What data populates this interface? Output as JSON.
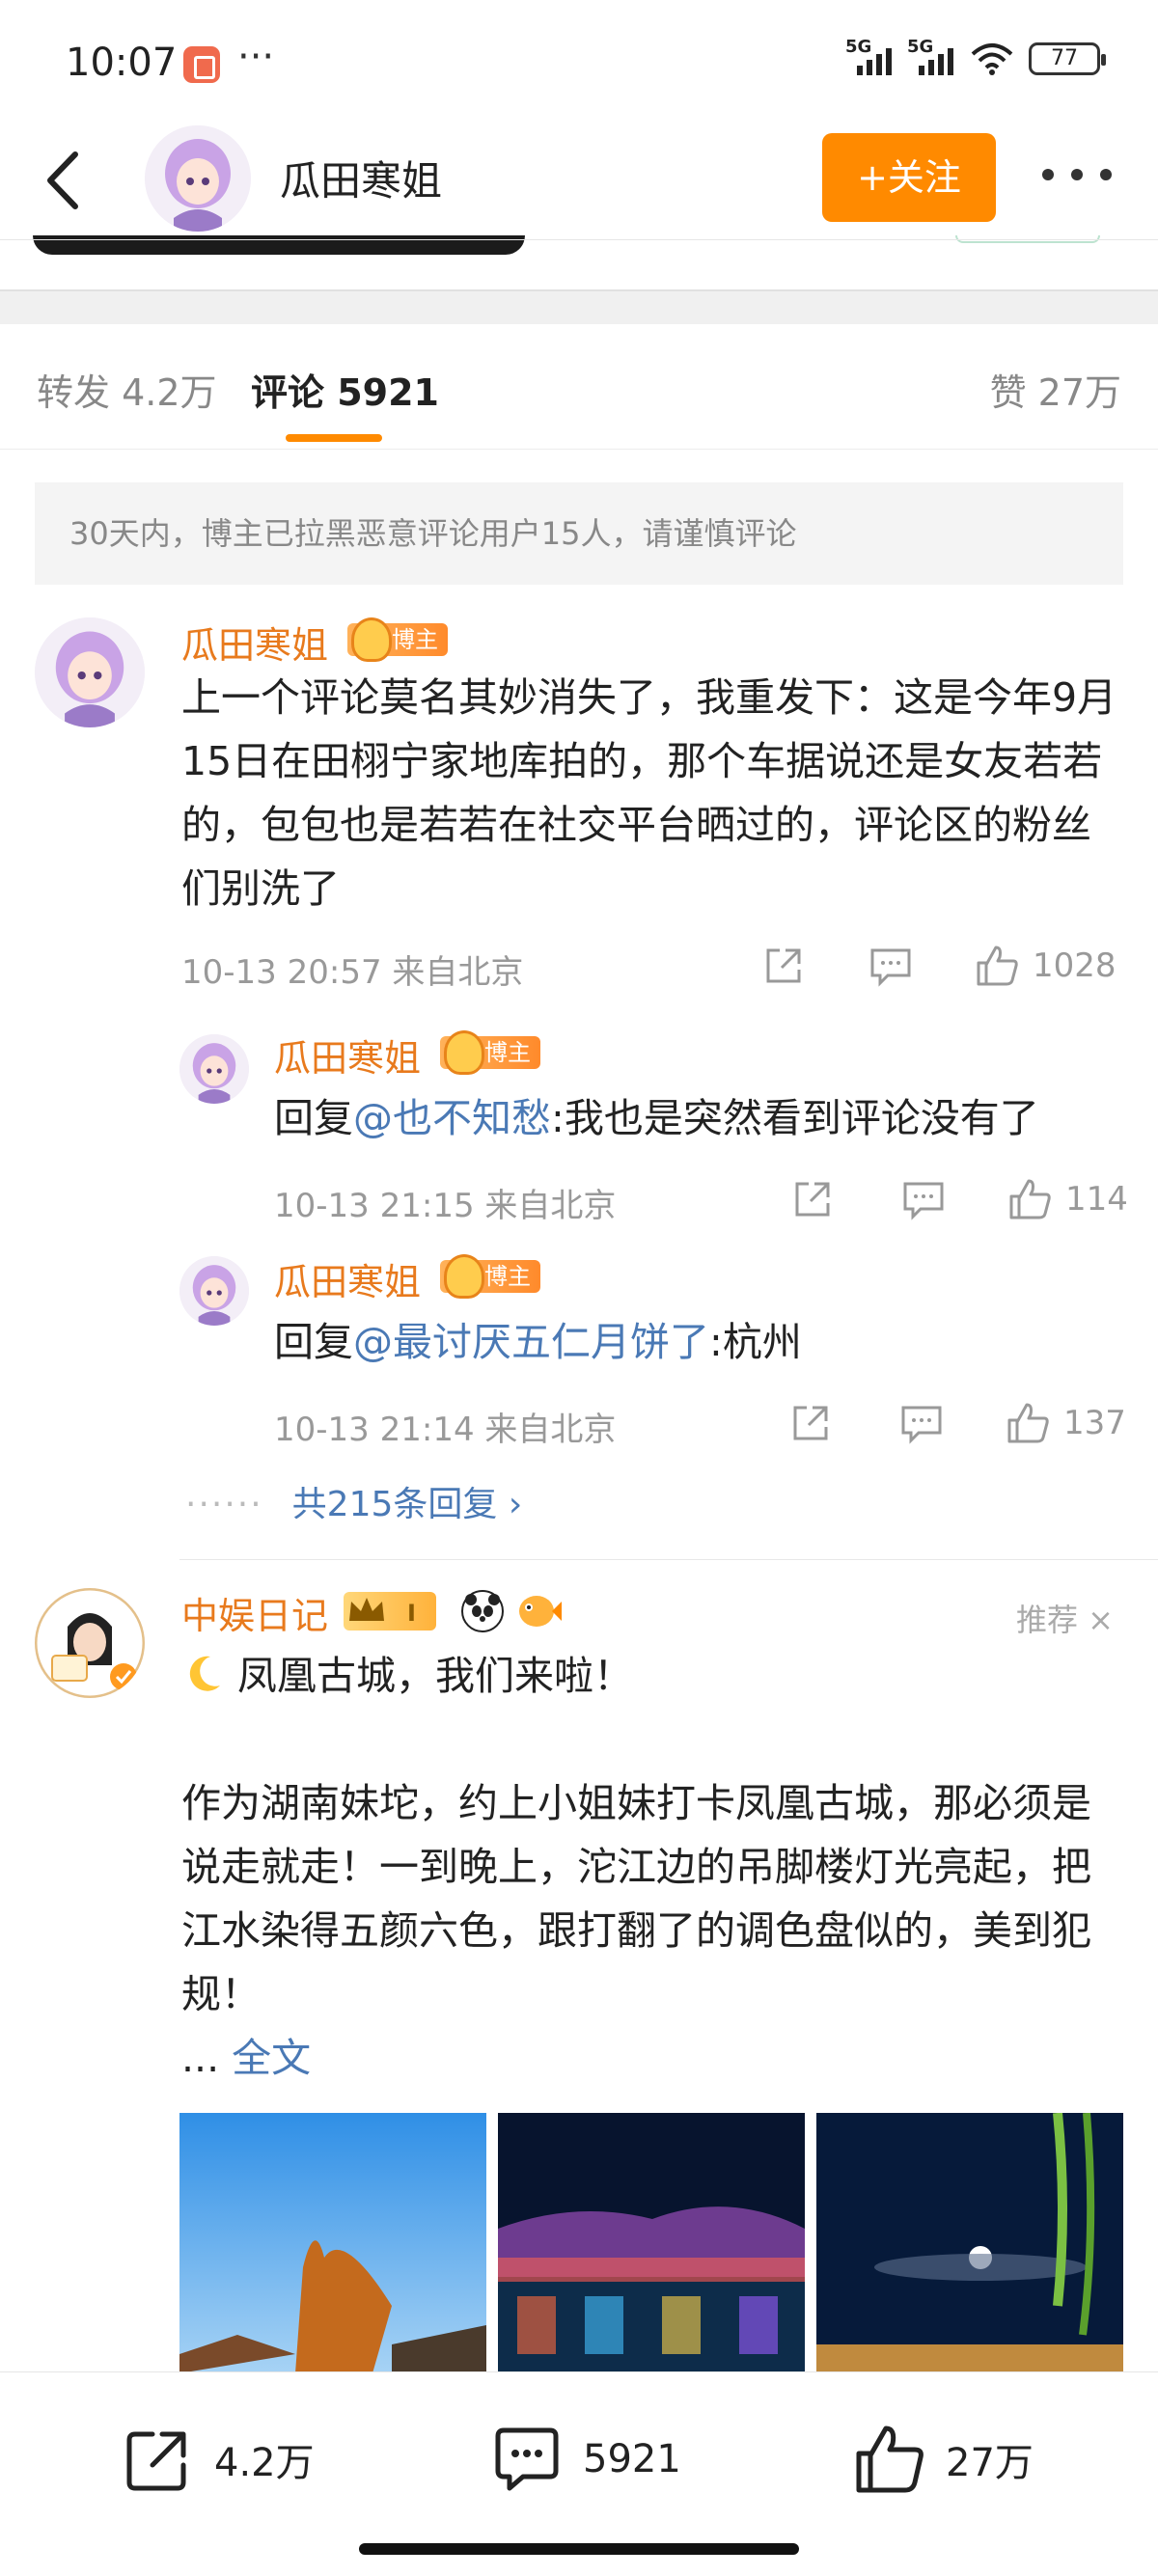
{
  "status_bar": {
    "time": "10:07",
    "signal_label_1": "5G",
    "signal_label_2": "5G",
    "battery": "77"
  },
  "header": {
    "name": "瓜田寒姐",
    "follow_label": "+关注"
  },
  "tabs": {
    "repost": "转发 4.2万",
    "comments": "评论 5921",
    "likes": "赞 27万"
  },
  "notice": "30天内，博主已拉黑恶意评论用户15人，请谨慎评论",
  "comments": [
    {
      "user": "瓜田寒姐",
      "badge": "博主",
      "text": "上一个评论莫名其妙消失了，我重发下：这是今年9月15日在田栩宁家地库拍的，那个车据说还是女友若若的，包包也是若若在社交平台晒过的，评论区的粉丝们别洗了",
      "time_location": "10-13 20:57  来自北京",
      "likes": "1028",
      "replies": [
        {
          "user": "瓜田寒姐",
          "badge": "博主",
          "prefix": "回复",
          "mention": "@也不知愁",
          "text": ":我也是突然看到评论没有了",
          "time_location": "10-13 21:15  来自北京",
          "likes": "114"
        },
        {
          "user": "瓜田寒姐",
          "badge": "博主",
          "prefix": "回复",
          "mention": "@最讨厌五仁月饼了",
          "text": ":杭州",
          "time_location": "10-13 21:14  来自北京",
          "likes": "137"
        }
      ],
      "more_replies": "共215条回复 ›"
    }
  ],
  "recommended_post": {
    "user": "中娱日记",
    "recommend_label": "推荐 ×",
    "line1": "凤凰古城，我们来啦！",
    "body": "作为湖南妹坨，约上小姐妹打卡凤凰古城，那必须是说走就走！一到晚上，沱江边的吊脚楼灯光亮起，把江水染得五颜六色，跟打翻了的调色盘似的，美到犯规！",
    "ellipsis": "... ",
    "full_text": "全文"
  },
  "bottom_bar": {
    "repost_count": "4.2万",
    "comment_count": "5921",
    "like_count": "27万"
  },
  "colors": {
    "accent": "#ff8a00",
    "username": "#e87a1d",
    "link": "#4a79b5"
  }
}
